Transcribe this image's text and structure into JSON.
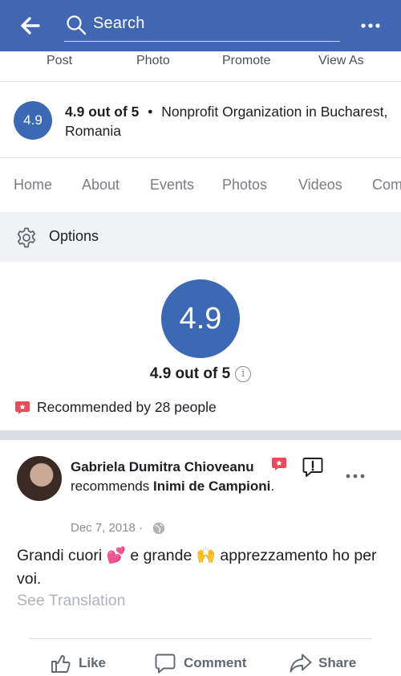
{
  "top_bar": {
    "search_placeholder": "Search",
    "back_icon": "arrow-left-icon",
    "more_icon": "more-horizontal-icon",
    "color": "#4267b2"
  },
  "page_actions": [
    "Post",
    "Photo",
    "Promote",
    "View As"
  ],
  "page_info": {
    "rating_badge": "4.9",
    "rating_text": "4.9 out of 5",
    "separator": "•",
    "category": "Nonprofit Organization in Bucharest, Romania"
  },
  "tabs": [
    "Home",
    "About",
    "Events",
    "Photos",
    "Videos",
    "Com"
  ],
  "options": {
    "label": "Options",
    "icon": "gear-icon"
  },
  "rating_summary": {
    "badge": "4.9",
    "score_text": "4.9 out of 5",
    "info_glyph": "i",
    "recommended_text": "Recommended by 28 people",
    "recommend_color": "#e94b5b"
  },
  "review": {
    "author": "Gabriela Dumitra Chioveanu",
    "recommends_word": "recommends",
    "page_name": "Inimi de Campioni",
    "period": ".",
    "date": "Dec 7, 2018",
    "date_separator": "·",
    "body": "Grandi cuori 💕 e grande 🙌 apprezzamento ho per voi.",
    "see_translation": "See Translation",
    "actions": {
      "like": "Like",
      "comment": "Comment",
      "share": "Share"
    }
  },
  "brand_color": "#3c68b4"
}
